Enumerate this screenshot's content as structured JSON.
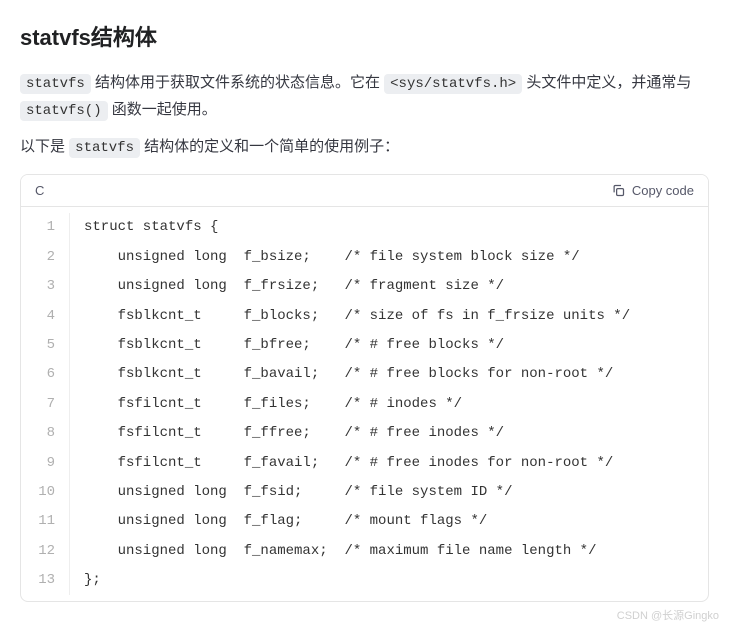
{
  "title": "statvfs结构体",
  "para1": {
    "seg1": "statvfs",
    "seg2": " 结构体用于获取文件系统的状态信息。它在 ",
    "seg3": "<sys/statvfs.h>",
    "seg4": " 头文件中定义，并通常与 ",
    "seg5": "statvfs()",
    "seg6": " 函数一起使用。"
  },
  "para2": {
    "seg1": "以下是 ",
    "seg2": "statvfs",
    "seg3": " 结构体的定义和一个简单的使用例子："
  },
  "code": {
    "lang": "C",
    "copy_label": "Copy code",
    "lines": [
      "struct statvfs {",
      "    unsigned long  f_bsize;    /* file system block size */",
      "    unsigned long  f_frsize;   /* fragment size */",
      "    fsblkcnt_t     f_blocks;   /* size of fs in f_frsize units */",
      "    fsblkcnt_t     f_bfree;    /* # free blocks */",
      "    fsblkcnt_t     f_bavail;   /* # free blocks for non-root */",
      "    fsfilcnt_t     f_files;    /* # inodes */",
      "    fsfilcnt_t     f_ffree;    /* # free inodes */",
      "    fsfilcnt_t     f_favail;   /* # free inodes for non-root */",
      "    unsigned long  f_fsid;     /* file system ID */",
      "    unsigned long  f_flag;     /* mount flags */",
      "    unsigned long  f_namemax;  /* maximum file name length */",
      "};"
    ]
  },
  "watermark": "CSDN @长源Gingko"
}
